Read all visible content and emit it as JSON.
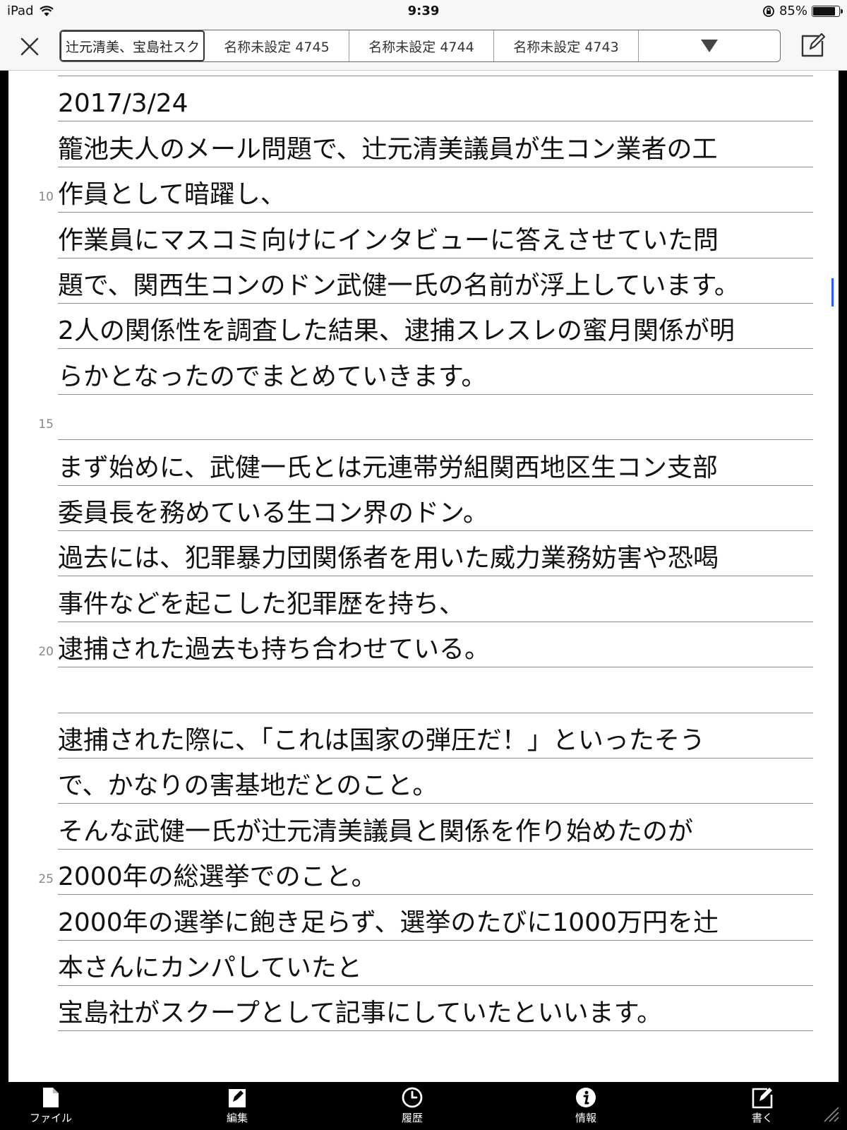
{
  "status": {
    "device": "iPad",
    "time": "9:39",
    "battery": "85%",
    "battery_level": 0.85
  },
  "tabs": [
    {
      "label": "辻元清美、宝島社スク",
      "active": true
    },
    {
      "label": "名称未設定 4745",
      "active": false
    },
    {
      "label": "名称未設定 4744",
      "active": false
    },
    {
      "label": "名称未設定 4743",
      "active": false
    }
  ],
  "document": {
    "lines": [
      {
        "text": "",
        "no": ""
      },
      {
        "text": "2017/3/24",
        "no": ""
      },
      {
        "text": "籠池夫人のメール問題で、辻元清美議員が生コン業者の工",
        "no": ""
      },
      {
        "text": "作員として暗躍し、",
        "no": "10"
      },
      {
        "text": "作業員にマスコミ向けにインタビューに答えさせていた問",
        "no": ""
      },
      {
        "text": "題で、関西生コンのドン武健一氏の名前が浮上しています。",
        "no": ""
      },
      {
        "text": "2人の関係性を調査した結果、逮捕スレスレの蜜月関係が明",
        "no": ""
      },
      {
        "text": "らかとなったのでまとめていきます。",
        "no": ""
      },
      {
        "text": "",
        "no": "15"
      },
      {
        "text": "まず始めに、武健一氏とは元連帯労組関西地区生コン支部",
        "no": ""
      },
      {
        "text": "委員長を務めている生コン界のドン。",
        "no": ""
      },
      {
        "text": "過去には、犯罪暴力団関係者を用いた威力業務妨害や恐喝",
        "no": ""
      },
      {
        "text": "事件などを起こした犯罪歴を持ち、",
        "no": ""
      },
      {
        "text": "逮捕された過去も持ち合わせている。",
        "no": "20"
      },
      {
        "text": "",
        "no": ""
      },
      {
        "text": "逮捕された際に、「これは国家の弾圧だ！」といったそう",
        "no": ""
      },
      {
        "text": "で、かなりの害基地だとのこと。",
        "no": ""
      },
      {
        "text": "そんな武健一氏が辻元清美議員と関係を作り始めたのが",
        "no": ""
      },
      {
        "text": "2000年の総選挙でのこと。",
        "no": "25"
      },
      {
        "text": "2000年の選挙に飽き足らず、選挙のたびに1000万円を辻",
        "no": ""
      },
      {
        "text": "本さんにカンパしていたと",
        "no": ""
      },
      {
        "text": "宝島社がスクープとして記事にしていたといいます。",
        "no": ""
      }
    ]
  },
  "toolbar": {
    "file": "ファイル",
    "edit": "編集",
    "history": "履歴",
    "info": "情報",
    "write": "書く"
  }
}
